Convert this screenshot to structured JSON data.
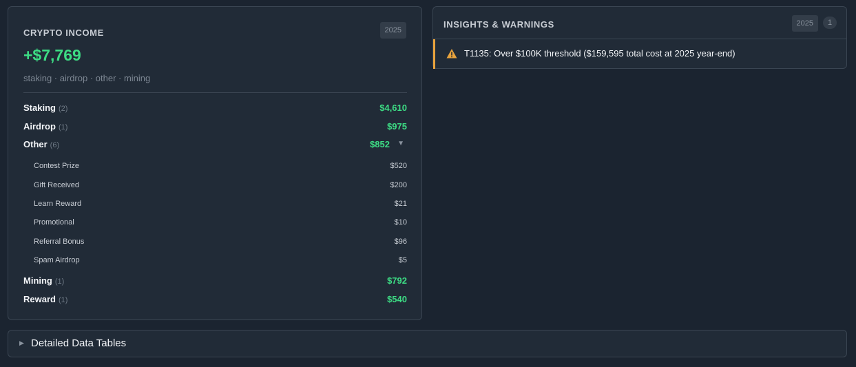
{
  "income": {
    "title": "CRYPTO INCOME",
    "year": "2025",
    "total": "+$7,769",
    "subtitle": "staking · airdrop · other · mining",
    "categories": [
      {
        "name": "Staking",
        "count": "(2)",
        "amount": "$4,610"
      },
      {
        "name": "Airdrop",
        "count": "(1)",
        "amount": "$975"
      },
      {
        "name": "Other",
        "count": "(6)",
        "amount": "$852",
        "toggle": "▼"
      },
      {
        "name": "Mining",
        "count": "(1)",
        "amount": "$792"
      },
      {
        "name": "Reward",
        "count": "(1)",
        "amount": "$540"
      }
    ],
    "other_items": [
      {
        "name": "Contest Prize",
        "amount": "$520"
      },
      {
        "name": "Gift Received",
        "amount": "$200"
      },
      {
        "name": "Learn Reward",
        "amount": "$21"
      },
      {
        "name": "Promotional",
        "amount": "$10"
      },
      {
        "name": "Referral Bonus",
        "amount": "$96"
      },
      {
        "name": "Spam Airdrop",
        "amount": "$5"
      }
    ]
  },
  "insights": {
    "title": "INSIGHTS & WARNINGS",
    "year": "2025",
    "count": "1",
    "warnings": [
      {
        "text": "T1135: Over $100K threshold ($159,595 total cost at 2025 year-end)",
        "icon": "warning-icon"
      }
    ]
  },
  "tables": {
    "arrow": "▶",
    "label": "Detailed Data Tables"
  },
  "colors": {
    "positive": "#3ddc84",
    "warning": "#e8a33d"
  }
}
